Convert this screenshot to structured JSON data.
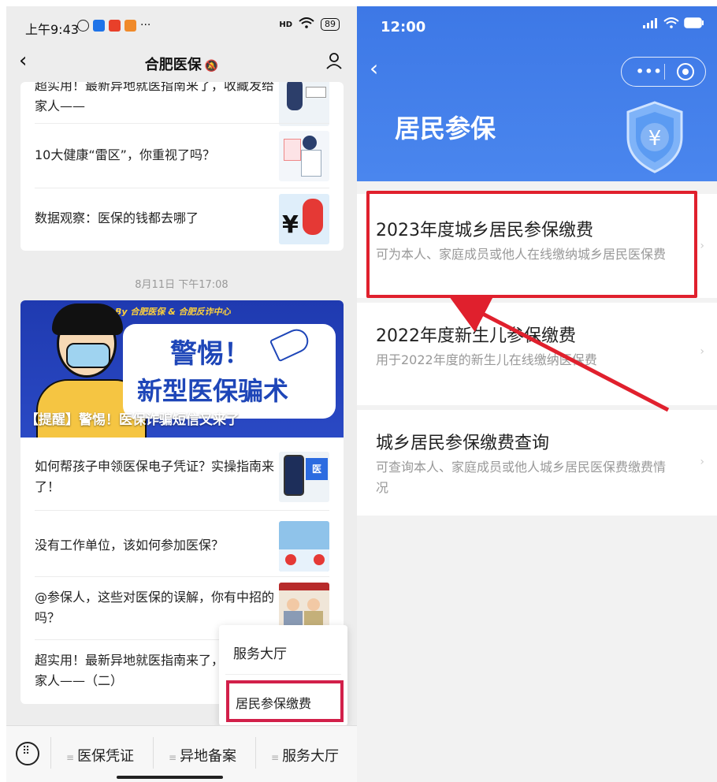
{
  "left": {
    "status": {
      "time": "上午9:43",
      "signal": "HD",
      "battery": "89"
    },
    "nav": {
      "title": "合肥医保"
    },
    "card1": {
      "items": [
        {
          "title": "超实用！最新异地就医指南来了，收藏发给家人——"
        },
        {
          "title": "10大健康“雷区”，你重视了吗？"
        },
        {
          "title": "数据观察：医保的钱都去哪了"
        }
      ]
    },
    "date": "8月11日 下午17:08",
    "banner": {
      "top_text": "By 合肥医保 & 合肥反诈中心",
      "line1": "警惕！",
      "line2": "新型医保骗术",
      "caption": "【提醒】警惕！医保诈骗短信又来了"
    },
    "card2": {
      "items": [
        {
          "title": "如何帮孩子申领医保电子凭证？实操指南来了！"
        },
        {
          "title": "没有工作单位，该如何参加医保？"
        },
        {
          "title": "@参保人，这些对医保的误解，你有中招的吗？"
        },
        {
          "title": "超实用！最新异地就医指南来了，收藏发给家人——（二）"
        }
      ]
    },
    "popup": {
      "item1": "服务大厅",
      "item2": "居民参保缴费"
    },
    "tabs": [
      "医保凭证",
      "异地备案",
      "服务大厅"
    ]
  },
  "right": {
    "status": {
      "time": "12:00"
    },
    "title": "居民参保",
    "items": [
      {
        "title": "2023年度城乡居民参保缴费",
        "sub": "可为本人、家庭成员或他人在线缴纳城乡居民医保费"
      },
      {
        "title": "2022年度新生儿参保缴费",
        "sub": "用于2022年度的新生儿在线缴纳医保费"
      },
      {
        "title": "城乡居民参保缴费查询",
        "sub": "可查询本人、家庭成员或他人城乡居民医保费缴费情况"
      }
    ],
    "shield_symbol": "¥"
  },
  "colors": {
    "highlight": "#e0202d",
    "header_blue": "#4a86ee",
    "popup_highlight": "#d2204a"
  }
}
